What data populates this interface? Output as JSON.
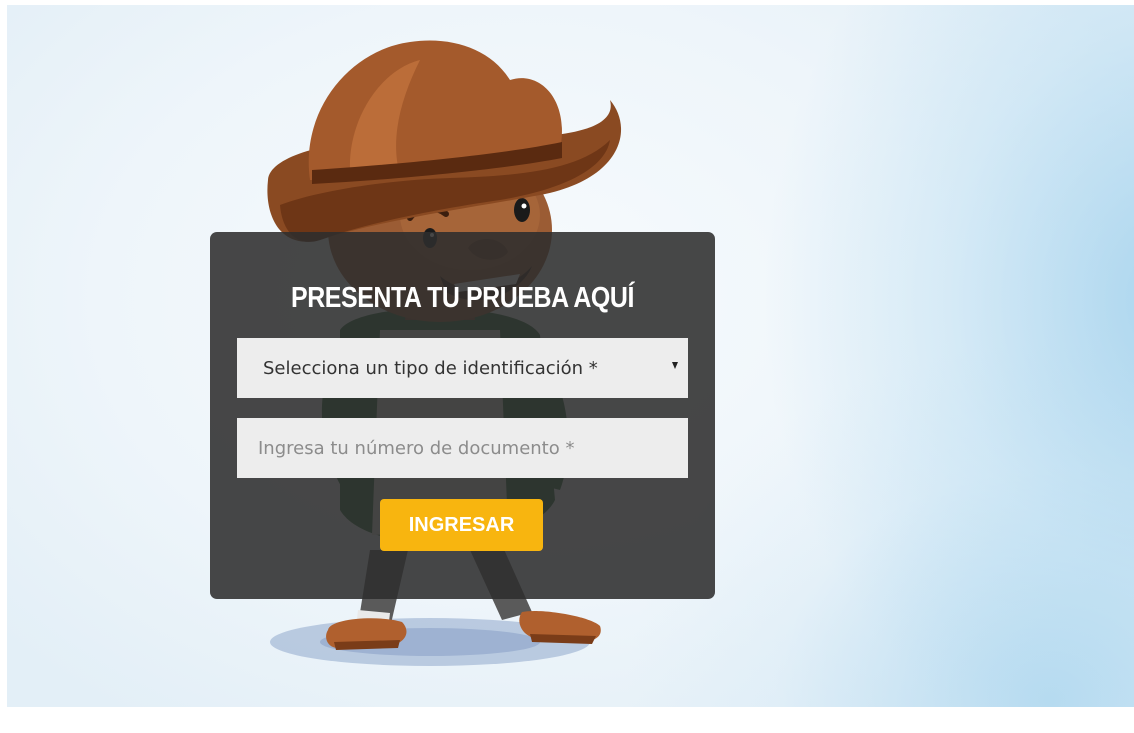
{
  "card": {
    "title": "PRESENTA TU PRUEBA AQUÍ"
  },
  "form": {
    "id_type_select": {
      "selected_value": "Selecciona un tipo de identificación *",
      "icon": "chevron-down-icon"
    },
    "document_input": {
      "value": "",
      "placeholder": "Ingresa tu número de documento *"
    },
    "submit_label": "INGRESAR"
  },
  "colors": {
    "card_background": "#2d2d2d",
    "button_accent": "#f8b50f",
    "field_background": "#ededed",
    "title_text": "#ffffff"
  }
}
